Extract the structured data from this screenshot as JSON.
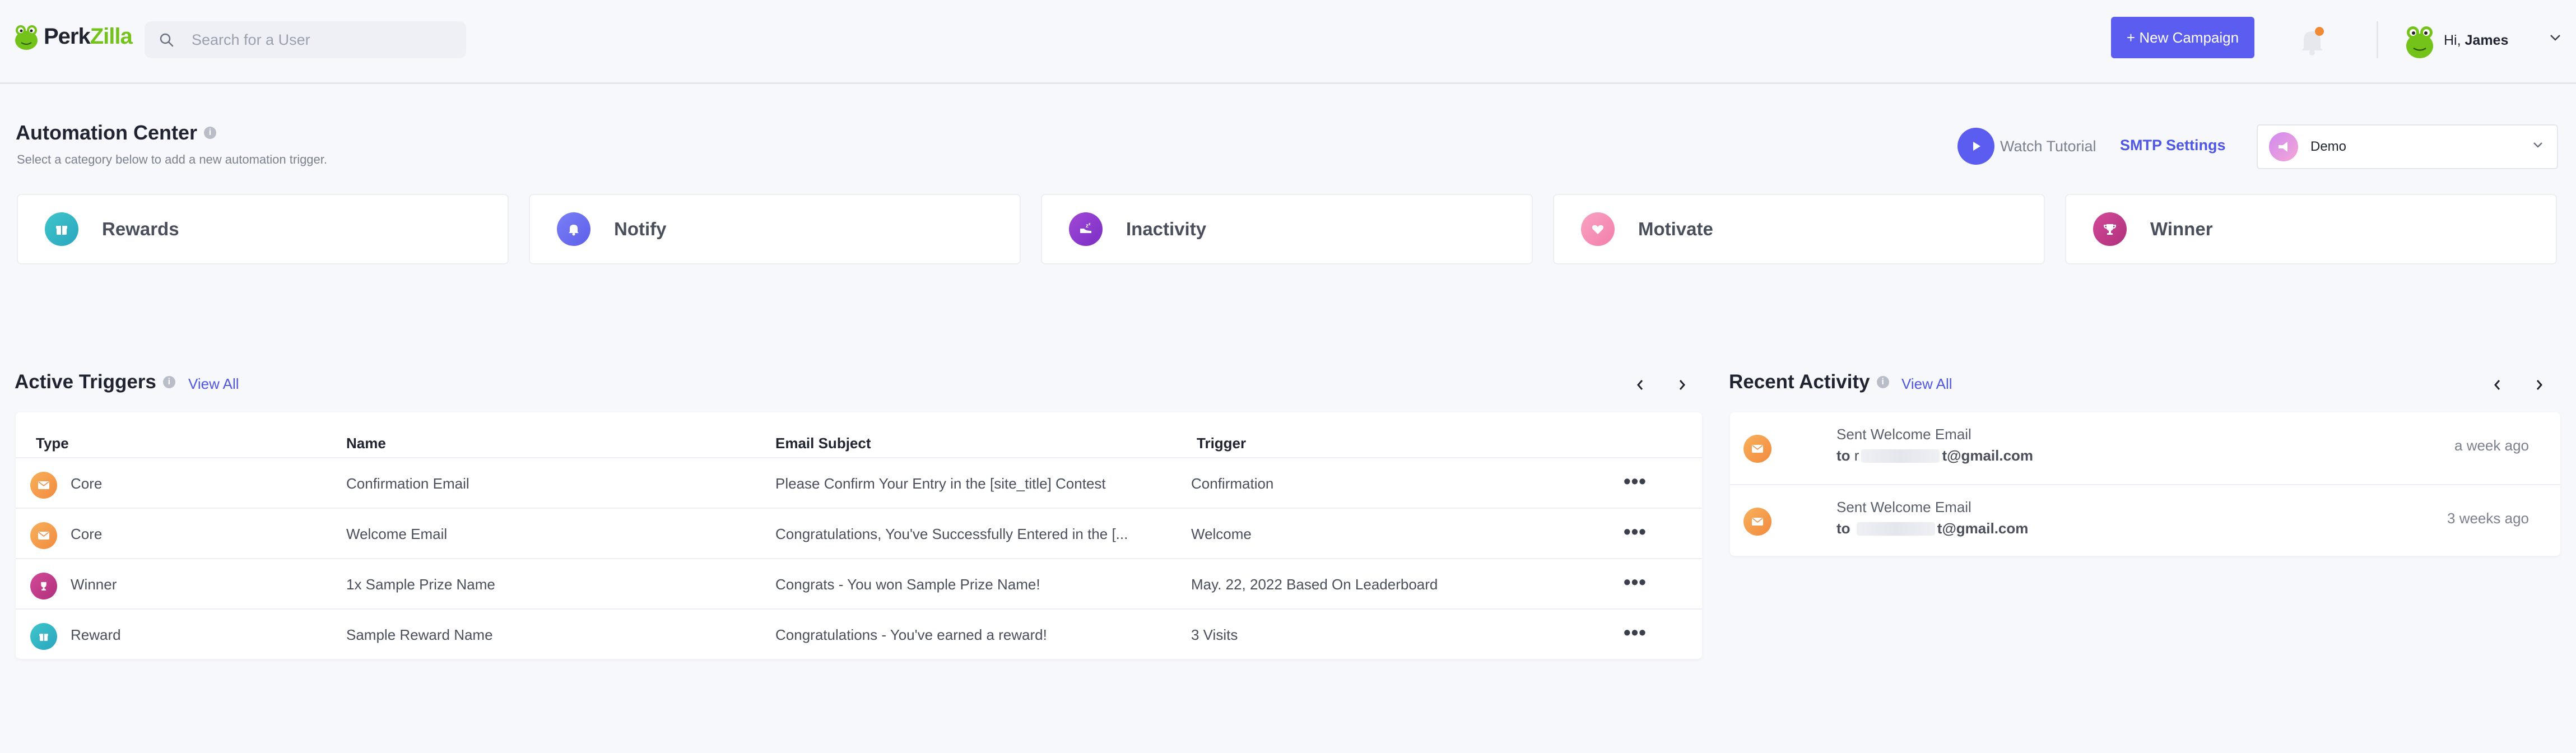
{
  "header": {
    "logo_part1": "Perk",
    "logo_part2": "Zilla",
    "search_placeholder": "Search for a User",
    "new_campaign_label": "+ New Campaign",
    "greeting": "Hi,",
    "user_name": "James"
  },
  "automation": {
    "title": "Automation Center",
    "subtitle": "Select a category below to add a new automation trigger.",
    "watch_label": "Watch Tutorial",
    "smtp_label": "SMTP Settings",
    "campaign_selected": "Demo",
    "categories": [
      {
        "label": "Rewards",
        "icon": "gift-icon",
        "color": "#2bb5c4"
      },
      {
        "label": "Notify",
        "icon": "bell-icon",
        "color": "#6c6ff2"
      },
      {
        "label": "Inactivity",
        "icon": "sleep-icon",
        "color": "#8f3fd3"
      },
      {
        "label": "Motivate",
        "icon": "heart-icon",
        "color": "#f58cb4"
      },
      {
        "label": "Winner",
        "icon": "trophy-icon",
        "color": "#c43a8a"
      }
    ]
  },
  "triggers": {
    "title": "Active Triggers",
    "view_all": "View All",
    "columns": [
      "Type",
      "Name",
      "Email Subject",
      "Trigger"
    ],
    "rows": [
      {
        "type": "Core",
        "name": "Confirmation Email",
        "subject": "Please Confirm Your Entry in the [site_title] Contest",
        "trigger": "Confirmation",
        "icon": "email-icon",
        "color": "#f39a4a"
      },
      {
        "type": "Core",
        "name": "Welcome Email",
        "subject": "Congratulations, You've Successfully Entered in the [...",
        "trigger": "Welcome",
        "icon": "email-icon",
        "color": "#f39a4a"
      },
      {
        "type": "Winner",
        "name": "1x Sample Prize Name",
        "subject": "Congrats - You won Sample Prize Name!",
        "trigger": "May. 22, 2022 Based On Leaderboard",
        "icon": "trophy-icon",
        "color": "#c43a8a"
      },
      {
        "type": "Reward",
        "name": "Sample Reward Name",
        "subject": "Congratulations - You've earned a reward!",
        "trigger": "3 Visits",
        "icon": "gift-icon",
        "color": "#2bb5c4"
      }
    ],
    "more_label": "•••"
  },
  "activity": {
    "title": "Recent Activity",
    "view_all": "View All",
    "items": [
      {
        "title": "Sent Welcome Email",
        "to_prefix": "to",
        "to_start": "r",
        "to_end": "t@gmail.com",
        "time": "a week ago"
      },
      {
        "title": "Sent Welcome Email",
        "to_prefix": "to",
        "to_start": "",
        "to_end": "t@gmail.com",
        "time": "3 weeks ago"
      }
    ]
  },
  "colors": {
    "accent": "#5b5cf0",
    "link": "#4f56e6",
    "notification_dot": "#f08a34"
  }
}
